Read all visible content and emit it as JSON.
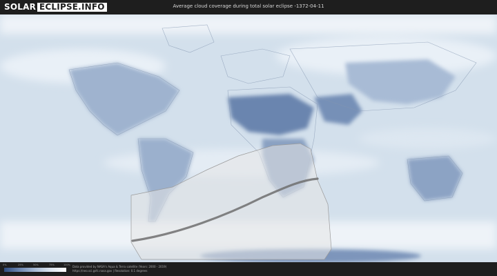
{
  "logo": {
    "part1": "SOLAR",
    "part2": "ECLIPSE.INFO"
  },
  "title": "Average cloud coverage during total solar eclipse -1372-04-11",
  "legend": {
    "ticks": [
      "0%",
      "25%",
      "50%",
      "75%",
      "100%"
    ],
    "colors": [
      "#2f4d80",
      "#6e88b2",
      "#a9bcd6",
      "#dde6f0",
      "#ffffff"
    ]
  },
  "credit": {
    "line1": "Data provided by NASA's Aqua & Terra satellite (Years: 2000 - 2019)",
    "line2": "https://neo.sci.gsfc.nasa.gov | Resolution: 0.1 degrees"
  },
  "colors": {
    "ocean_cloud": "#d3e0ec",
    "clear_land": "#5f7aa6",
    "path_overlay": "#e6e6e6",
    "central_line": "#6f6f6f"
  }
}
